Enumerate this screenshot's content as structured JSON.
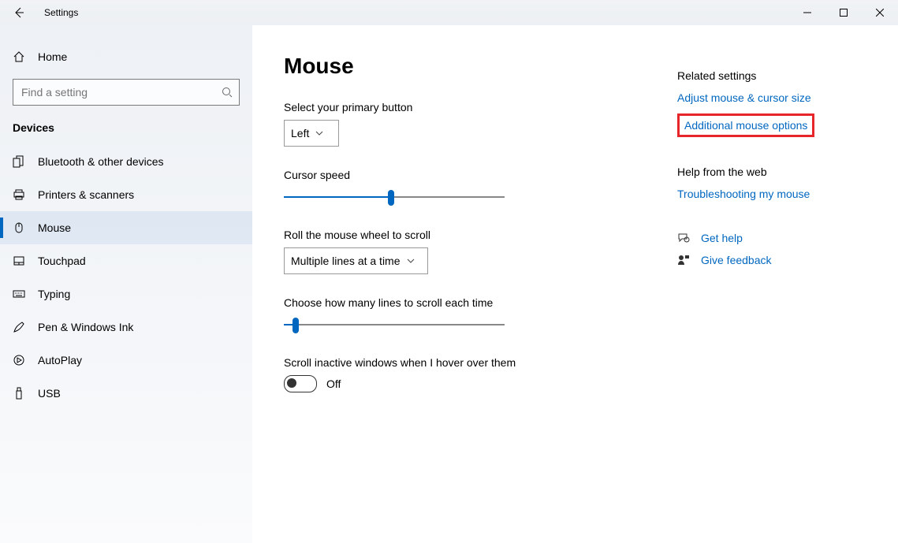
{
  "title": "Settings",
  "sidebar": {
    "home": "Home",
    "search_placeholder": "Find a setting",
    "category": "Devices",
    "items": [
      {
        "label": "Bluetooth & other devices"
      },
      {
        "label": "Printers & scanners"
      },
      {
        "label": "Mouse"
      },
      {
        "label": "Touchpad"
      },
      {
        "label": "Typing"
      },
      {
        "label": "Pen & Windows Ink"
      },
      {
        "label": "AutoPlay"
      },
      {
        "label": "USB"
      }
    ]
  },
  "page": {
    "heading": "Mouse",
    "primary_label": "Select your primary button",
    "primary_value": "Left",
    "cursor_speed_label": "Cursor speed",
    "cursor_speed_percent": 47,
    "scroll_label": "Roll the mouse wheel to scroll",
    "scroll_value": "Multiple lines at a time",
    "lines_label": "Choose how many lines to scroll each time",
    "lines_percent": 4,
    "inactive_label": "Scroll inactive windows when I hover over them",
    "inactive_state": "Off"
  },
  "related": {
    "heading": "Related settings",
    "link1": "Adjust mouse & cursor size",
    "link2": "Additional mouse options",
    "help_heading": "Help from the web",
    "help_link": "Troubleshooting my mouse",
    "get_help": "Get help",
    "feedback": "Give feedback"
  }
}
